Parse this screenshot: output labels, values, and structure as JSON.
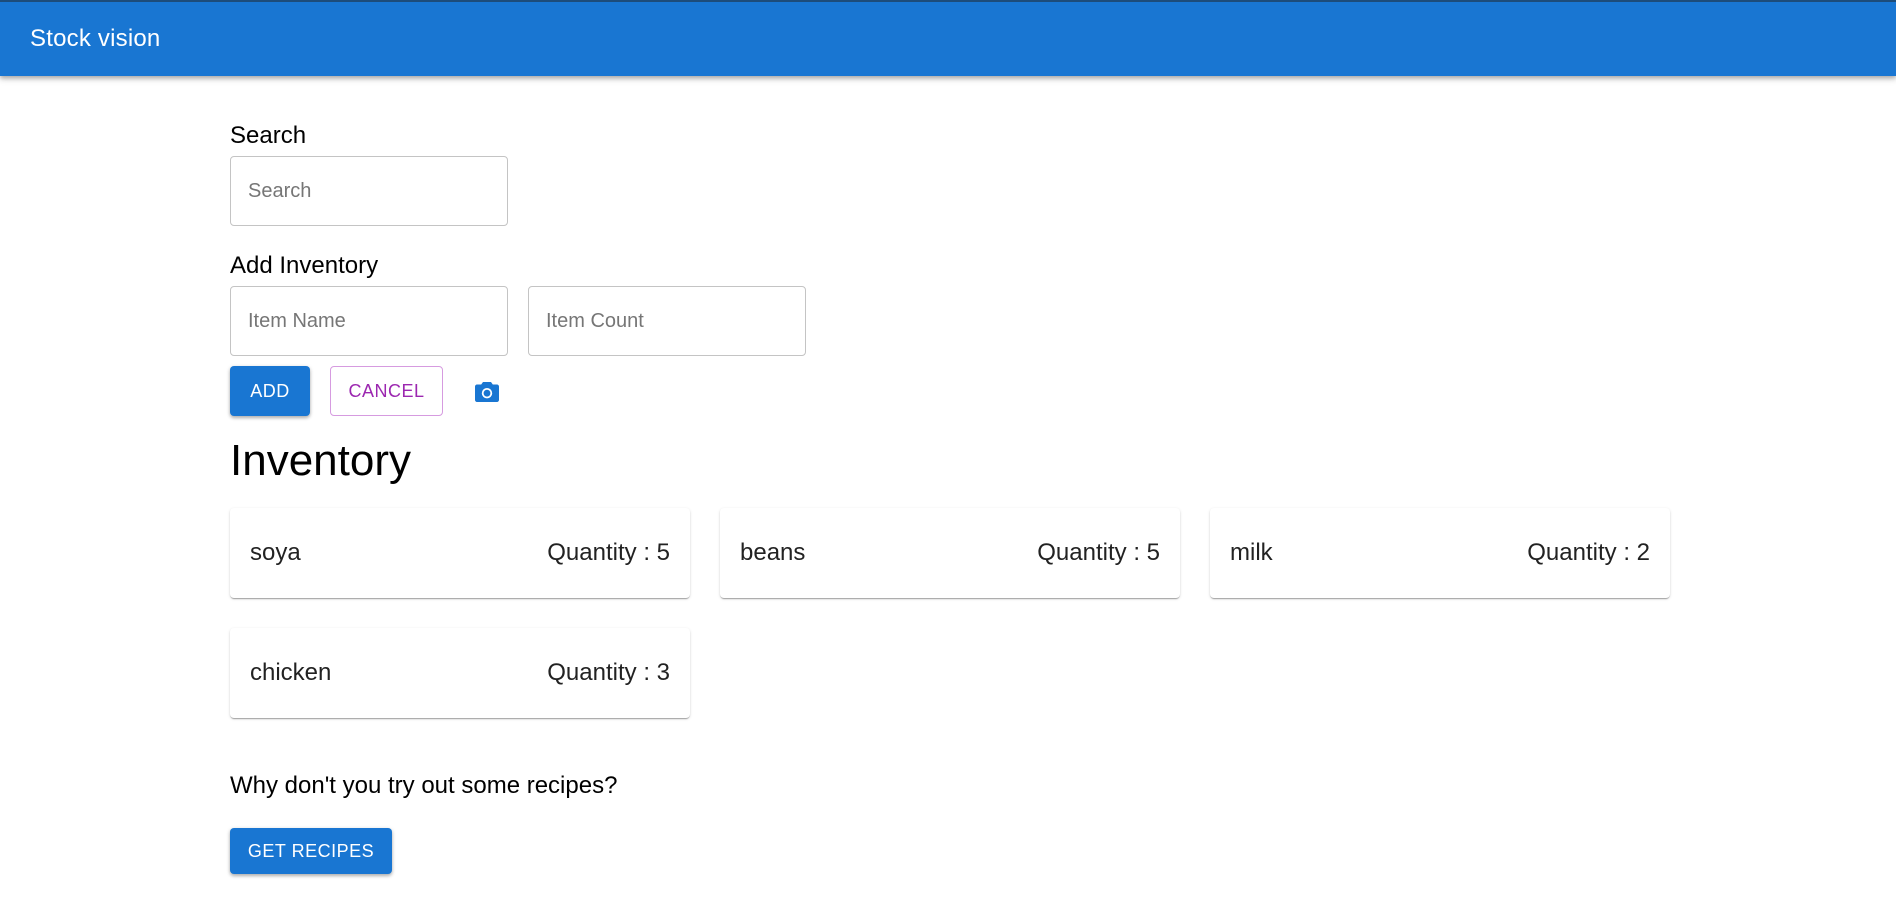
{
  "app": {
    "title": "Stock vision"
  },
  "search": {
    "label": "Search",
    "placeholder": "Search",
    "value": ""
  },
  "add_inventory": {
    "label": "Add Inventory",
    "item_name_placeholder": "Item Name",
    "item_count_placeholder": "Item Count",
    "add_label": "ADD",
    "cancel_label": "CANCEL",
    "camera_icon": "camera-icon"
  },
  "inventory": {
    "heading": "Inventory",
    "items": [
      {
        "name": "soya",
        "quantity_text": "Quantity : 5"
      },
      {
        "name": "beans",
        "quantity_text": "Quantity : 5"
      },
      {
        "name": "milk",
        "quantity_text": "Quantity : 2"
      },
      {
        "name": "chicken",
        "quantity_text": "Quantity : 3"
      }
    ]
  },
  "recipes": {
    "prompt": "Why don't you try out some recipes?",
    "button_label": "GET RECIPES"
  },
  "colors": {
    "primary": "#1976d2",
    "secondary": "#9c27b0"
  }
}
